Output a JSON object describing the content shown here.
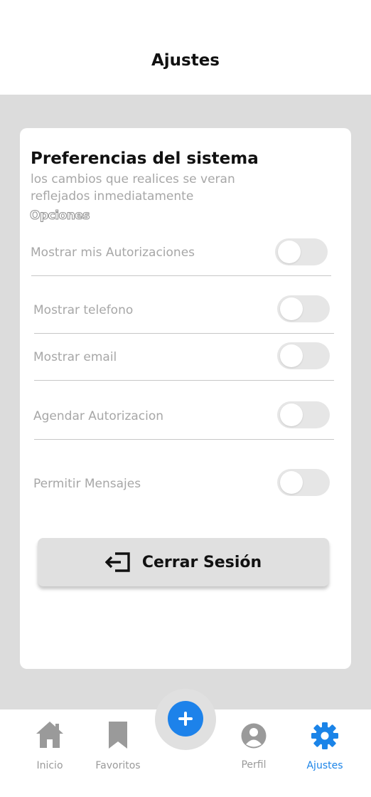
{
  "header": {
    "title": "Ajustes"
  },
  "card": {
    "title": "Preferencias del sistema",
    "description": "los cambios que realices se veran reflejados inmediatamente",
    "section_label": "Opciones",
    "settings": [
      {
        "label": "Mostrar  mis Autorizaciones",
        "enabled": false
      },
      {
        "label": "Mostrar  telefono",
        "enabled": false
      },
      {
        "label": "Mostrar  email",
        "enabled": false
      },
      {
        "label": "Agendar Autorizacion",
        "enabled": false
      },
      {
        "label": "Permitir Mensajes",
        "enabled": false
      }
    ],
    "logout": {
      "label": "Cerrar Sesión",
      "icon": "logout-icon"
    }
  },
  "tabbar": {
    "tabs": [
      {
        "label": "Inicio",
        "icon": "home-icon",
        "active": false
      },
      {
        "label": "Favoritos",
        "icon": "bookmark-icon",
        "active": false
      },
      {
        "label": "Perfil",
        "icon": "profile-icon",
        "active": false
      },
      {
        "label": "Ajustes",
        "icon": "gear-icon",
        "active": true
      }
    ],
    "fab_icon": "plus-icon"
  },
  "colors": {
    "accent": "#1d82ea",
    "active_tab": "#1b84e8",
    "background": "#dcdcdc",
    "muted_text": "#a7a7a7"
  }
}
